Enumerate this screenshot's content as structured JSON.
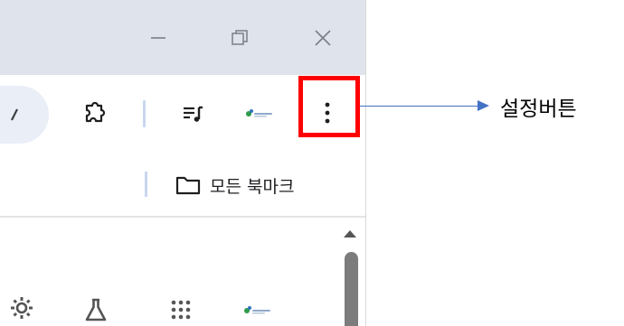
{
  "bookmarks_bar": {
    "all_bookmarks_label": "모든 북마크"
  },
  "annotation": {
    "label": "설정버튼",
    "arrow_color": "#4472c4",
    "highlight_color": "#ff0000"
  },
  "icons": {
    "window_controls": [
      "minimize-icon",
      "restore-icon",
      "close-icon"
    ],
    "toolbar": [
      "extensions-icon",
      "media-control-icon",
      "site-logo-icon",
      "more-menu-icon"
    ],
    "content": [
      "gear-icon",
      "flask-icon",
      "apps-grid-icon",
      "site-logo-icon"
    ]
  }
}
